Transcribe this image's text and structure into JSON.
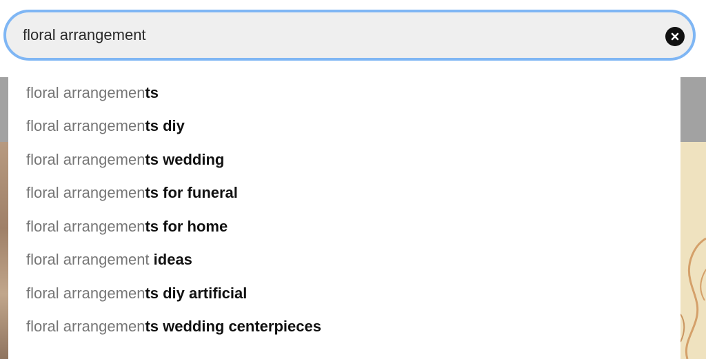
{
  "search": {
    "value": "floral arrangement",
    "clear_icon": "close-circle-icon"
  },
  "suggestions": [
    {
      "prefix": "floral arrangemen",
      "suffix": "ts",
      "highlight": ""
    },
    {
      "prefix": "floral arrangemen",
      "suffix": "ts diy",
      "highlight": ""
    },
    {
      "prefix": "floral arrangemen",
      "suffix": "ts wedding",
      "highlight": ""
    },
    {
      "prefix": "floral arrangemen",
      "suffix": "ts for funeral",
      "highlight": ""
    },
    {
      "prefix": "floral arrangemen",
      "suffix": "ts for home",
      "highlight": ""
    },
    {
      "prefix": "floral arrangement ",
      "suffix": "ideas",
      "highlight": ""
    },
    {
      "prefix": "floral arrangemen",
      "suffix": "ts diy artificial",
      "highlight": ""
    },
    {
      "prefix": "floral arrangemen",
      "suffix": "ts wedding centerpieces",
      "highlight": ""
    }
  ],
  "colors": {
    "focus_ring": "#7fb6f4",
    "search_bg": "#efefef",
    "prefix_text": "#767676",
    "suffix_text": "#111111"
  }
}
